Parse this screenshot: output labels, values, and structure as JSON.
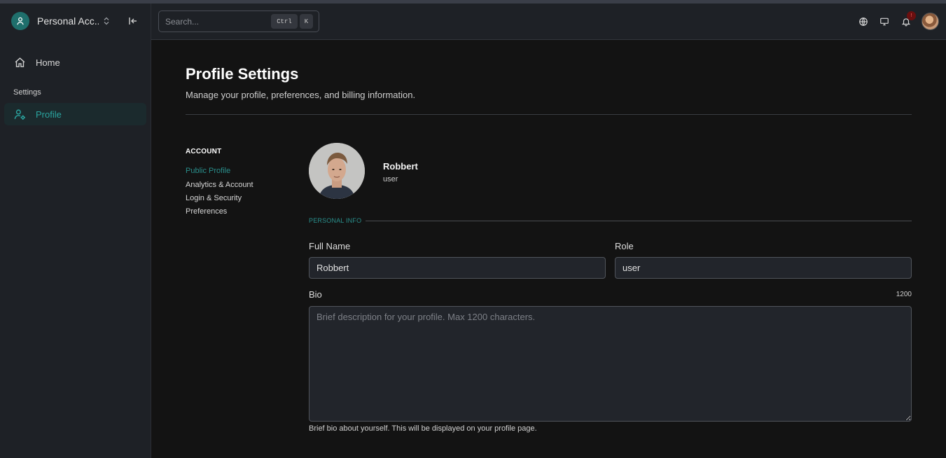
{
  "colors": {
    "accent": "#2aa5a0",
    "background": "#131313",
    "sidebar": "#1e2126",
    "notification": "#6b0f0f"
  },
  "sidebar": {
    "account_name": "Personal Acc...",
    "items": [
      {
        "label": "Home",
        "icon": "home-icon"
      },
      {
        "label": "Profile",
        "icon": "user-cog-icon",
        "active": true
      }
    ],
    "section_label": "Settings"
  },
  "header": {
    "search": {
      "placeholder": "Search...",
      "shortcut_ctrl": "Ctrl",
      "shortcut_key": "K"
    },
    "notification_count": "!"
  },
  "page": {
    "title": "Profile Settings",
    "subtitle": "Manage your profile, preferences, and billing information."
  },
  "subnav": {
    "heading": "ACCOUNT",
    "links": [
      "Public Profile",
      "Analytics & Account",
      "Login & Security",
      "Preferences"
    ]
  },
  "profile": {
    "name": "Robbert",
    "role": "user"
  },
  "personal_info": {
    "section_label": "PERSONAL INFO",
    "full_name_label": "Full Name",
    "full_name_value": "Robbert",
    "role_label": "Role",
    "role_value": "user",
    "bio_label": "Bio",
    "bio_count": "1200",
    "bio_placeholder": "Brief description for your profile. Max 1200 characters.",
    "bio_value": "",
    "bio_help": "Brief bio about yourself. This will be displayed on your profile page."
  }
}
